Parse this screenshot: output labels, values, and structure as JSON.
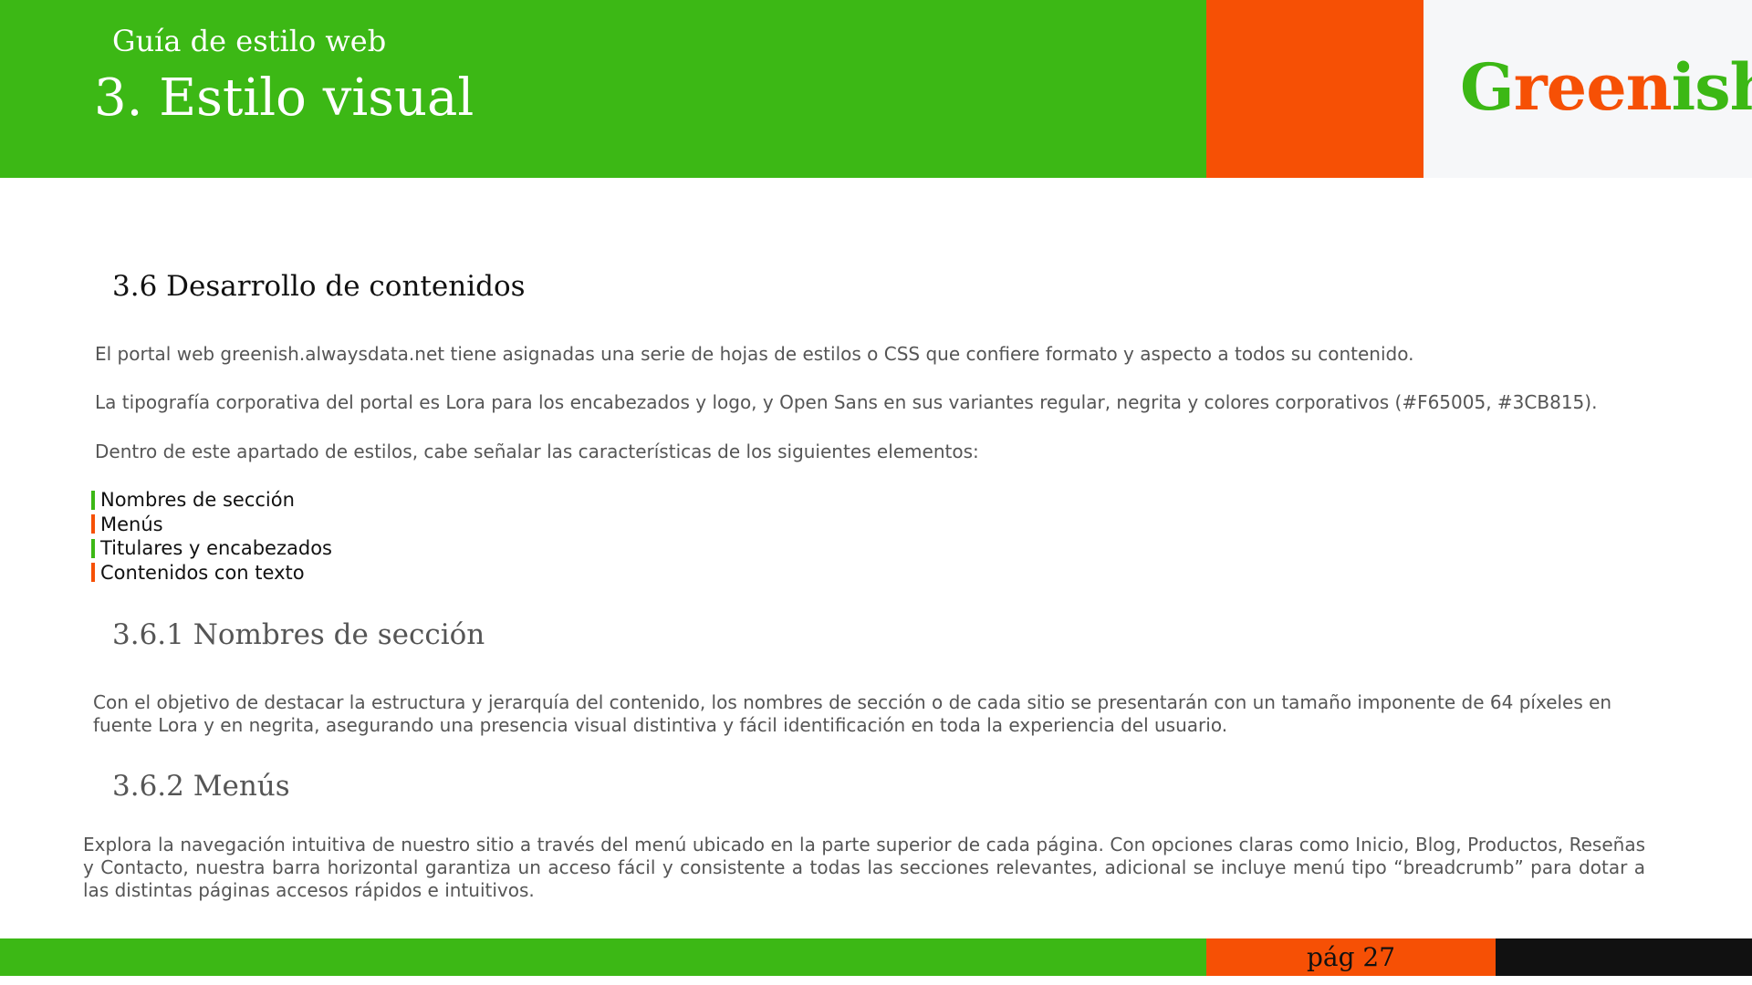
{
  "header": {
    "subtitle": "Guía de estilo web",
    "title": "3. Estilo visual",
    "logo": {
      "part1": "G",
      "part2": "reen",
      "part3": "ish"
    }
  },
  "colors": {
    "green": "#3CB815",
    "orange": "#F65005",
    "logo_background": "#F6F7F9",
    "dark": "#111111",
    "text": "#555555"
  },
  "section": {
    "heading": "3.6 Desarrollo de contenidos",
    "para1": "El portal web greenish.alwaysdata.net tiene asignadas una serie de hojas de estilos o CSS que confiere formato y aspecto a todos su contenido.",
    "para2": "La tipografía corporativa del portal es Lora para los encabezados y logo, y Open Sans en sus variantes regular, negrita y colores corporativos (#F65005, #3CB815).",
    "para3": "Dentro de este apartado de estilos, cabe señalar las características de los siguientes elementos:",
    "list": [
      "Nombres de sección",
      "Menús",
      "Titulares y encabezados",
      "Contenidos con texto"
    ]
  },
  "subsection1": {
    "heading": "3.6.1 Nombres de sección",
    "text": "Con el objetivo de destacar la estructura y jerarquía del contenido, los nombres de sección o de cada sitio se presentarán con un tamaño imponente de 64 píxeles en fuente Lora y en negrita, asegurando una presencia visual distintiva y fácil identificación en toda la experiencia del usuario."
  },
  "subsection2": {
    "heading": "3.6.2 Menús",
    "text": "Explora la navegación intuitiva de nuestro sitio a través del menú ubicado en la parte superior de cada página. Con opciones claras como Inicio, Blog, Productos, Reseñas y Contacto, nuestra barra horizontal garantiza un acceso fácil y consistente a todas las secciones relevantes, adicional se incluye menú tipo “breadcrumb” para dotar a las distintas páginas accesos rápidos e intuitivos."
  },
  "footer": {
    "page": "pág 27"
  }
}
